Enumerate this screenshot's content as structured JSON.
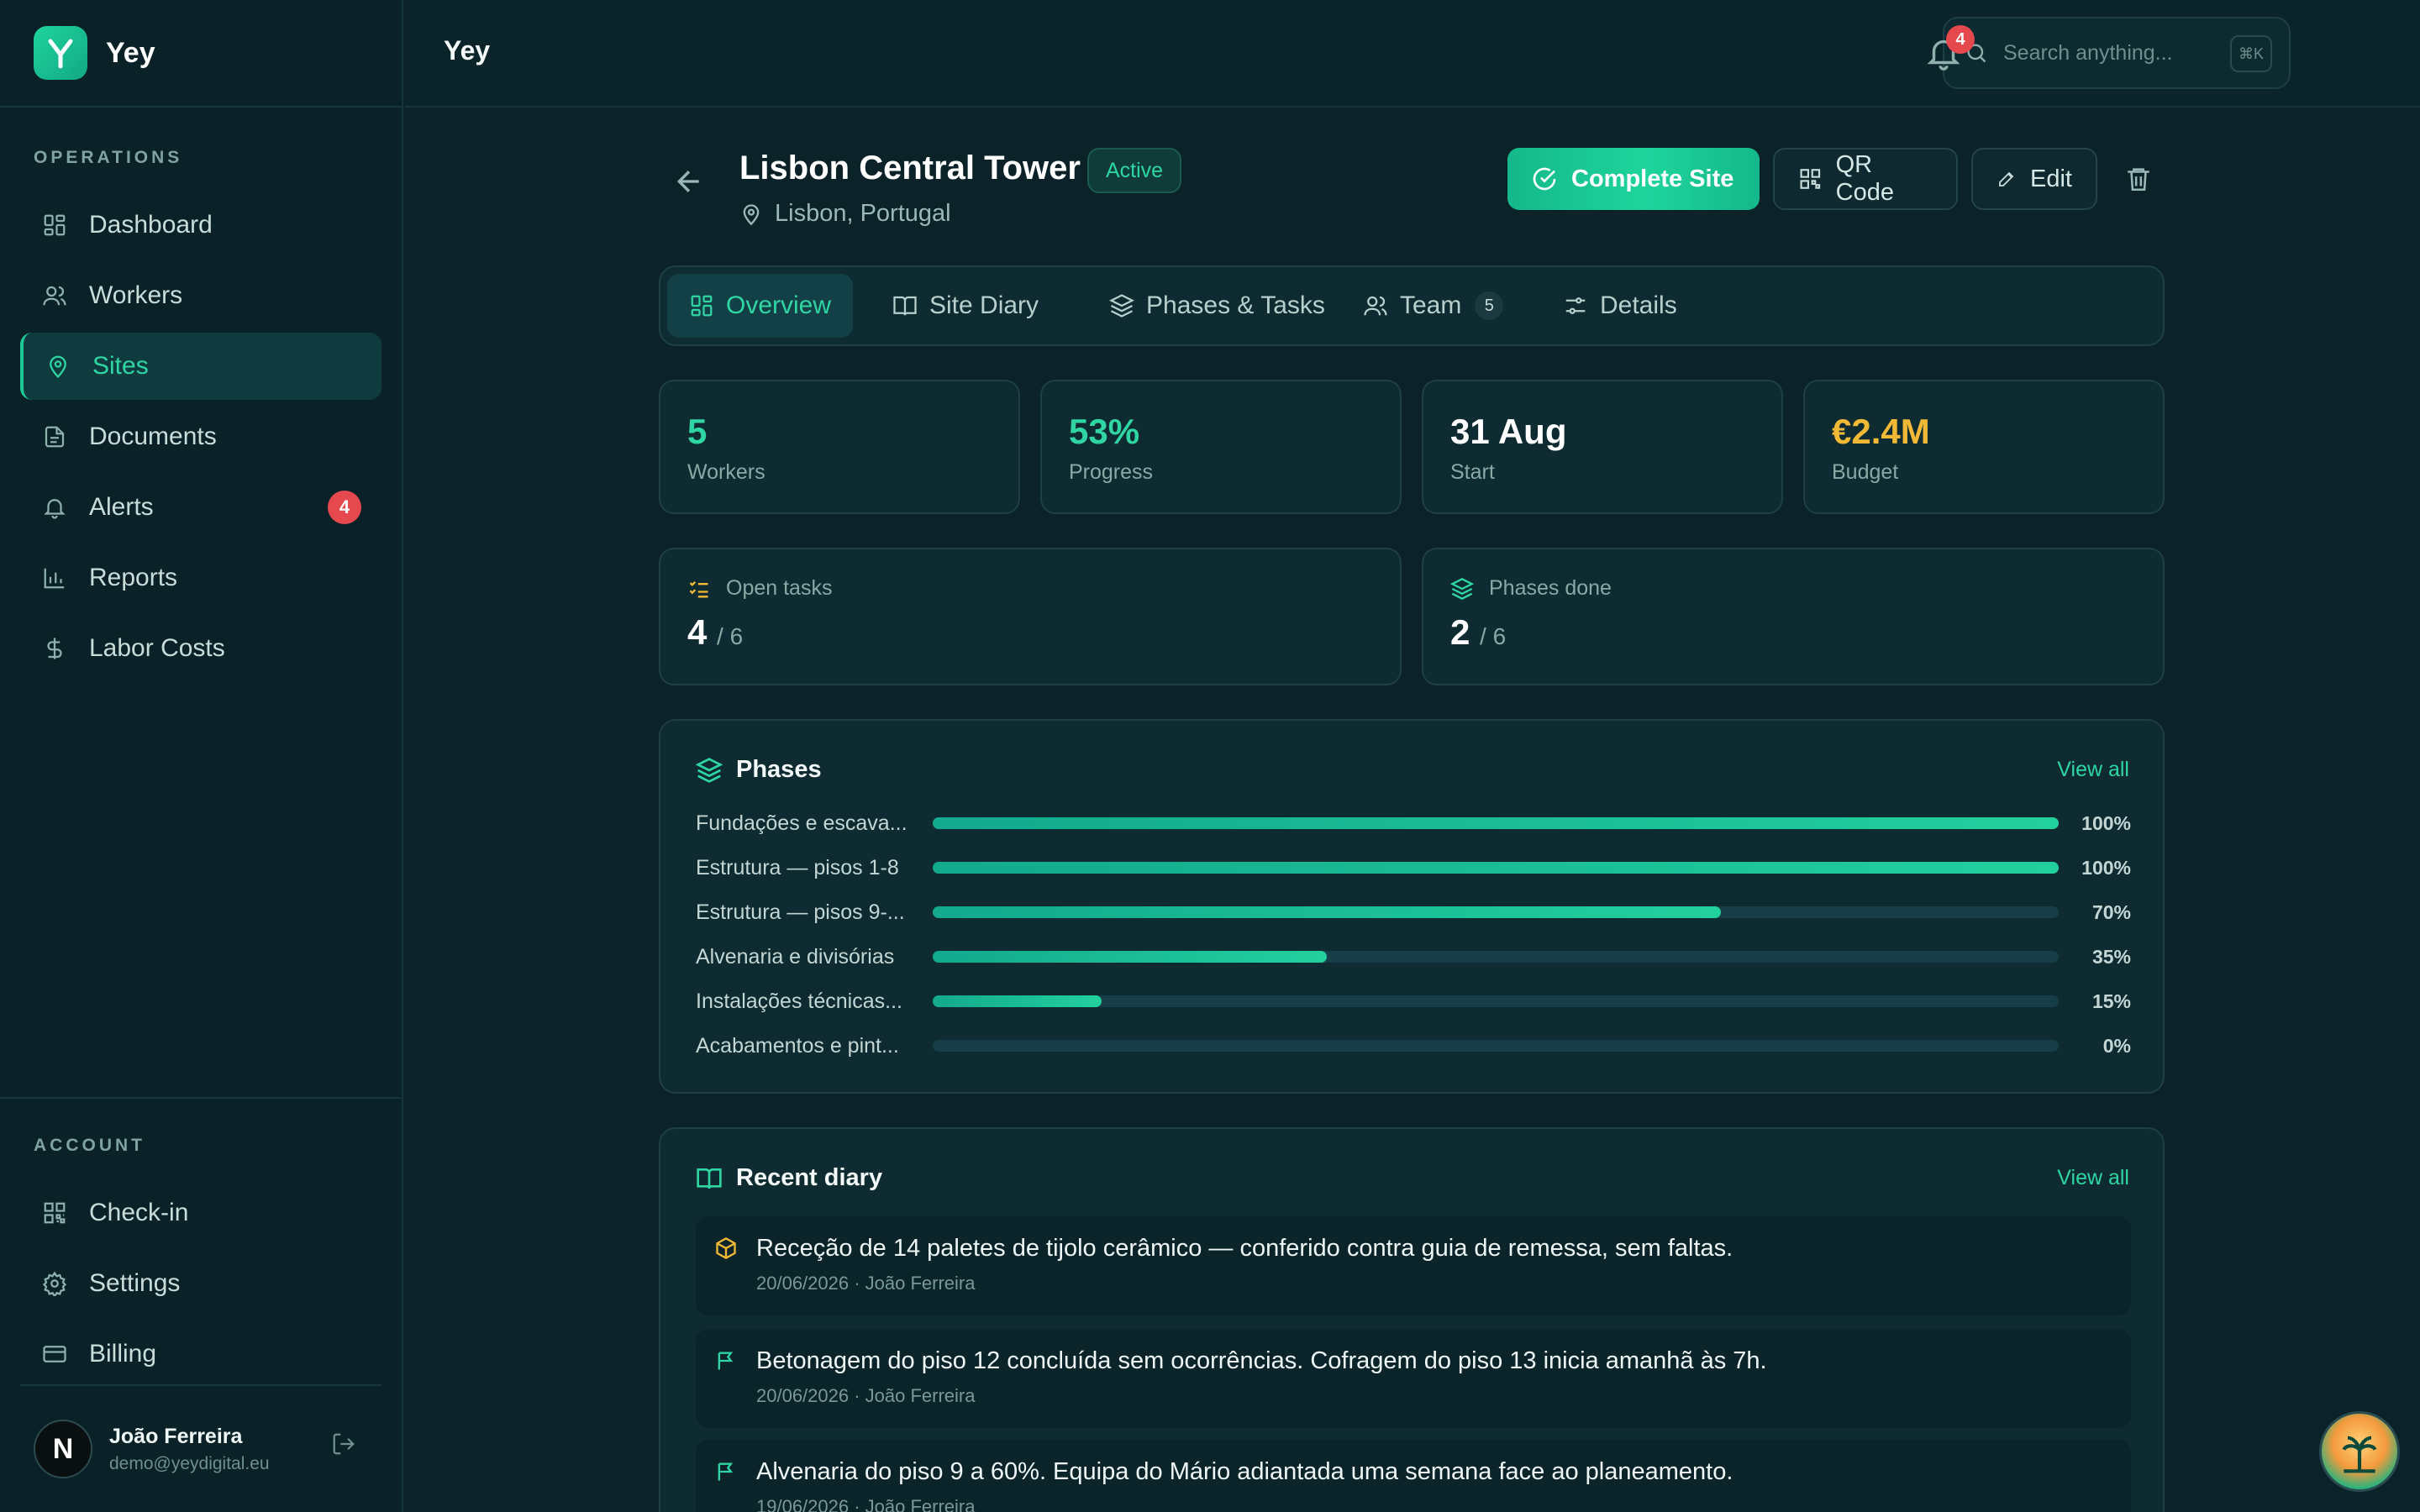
{
  "brand": {
    "name": "Yey"
  },
  "sidebar": {
    "operations_label": "OPERATIONS",
    "items": [
      {
        "label": "Dashboard",
        "icon": "grid-icon"
      },
      {
        "label": "Workers",
        "icon": "users-icon"
      },
      {
        "label": "Sites",
        "icon": "map-pin-icon",
        "active": true
      },
      {
        "label": "Documents",
        "icon": "file-icon"
      },
      {
        "label": "Alerts",
        "icon": "bell-icon",
        "badge": "4"
      },
      {
        "label": "Reports",
        "icon": "bar-chart-icon"
      },
      {
        "label": "Labor Costs",
        "icon": "dollar-icon"
      }
    ],
    "account_label": "ACCOUNT",
    "account_items": [
      {
        "label": "Check-in",
        "icon": "qr-icon"
      },
      {
        "label": "Settings",
        "icon": "gear-icon"
      },
      {
        "label": "Billing",
        "icon": "credit-card-icon"
      }
    ],
    "user": {
      "initial": "N",
      "name": "João Ferreira",
      "email": "demo@yeydigital.eu"
    }
  },
  "topbar": {
    "title": "Yey",
    "search_placeholder": "Search anything...",
    "shortcut": "⌘K",
    "notifications": "4"
  },
  "site": {
    "name": "Lisbon Central Tower",
    "status": "Active",
    "location": "Lisbon, Portugal"
  },
  "actions": {
    "complete": "Complete Site",
    "qr": "QR Code",
    "edit": "Edit"
  },
  "tabs": [
    {
      "label": "Overview",
      "active": true
    },
    {
      "label": "Site Diary"
    },
    {
      "label": "Phases & Tasks"
    },
    {
      "label": "Team",
      "count": "5"
    },
    {
      "label": "Details"
    }
  ],
  "stats": [
    {
      "value": "5",
      "label": "Workers",
      "color": "#2fd6a3"
    },
    {
      "value": "53%",
      "label": "Progress",
      "color": "#2fd6a3"
    },
    {
      "value": "31 Aug",
      "label": "Start",
      "color": "#ffffff"
    },
    {
      "value": "€2.4M",
      "label": "Budget",
      "color": "#f2b937"
    }
  ],
  "open_tasks": {
    "label": "Open tasks",
    "value": "4",
    "total": "/ 6"
  },
  "phases_done": {
    "label": "Phases done",
    "value": "2",
    "total": "/ 6"
  },
  "phases_card": {
    "title": "Phases",
    "view_all": "View all",
    "items": [
      {
        "name": "Fundações e escava...",
        "progress": 100,
        "pct": "100%"
      },
      {
        "name": "Estrutura — pisos 1-8",
        "progress": 100,
        "pct": "100%"
      },
      {
        "name": "Estrutura — pisos 9-...",
        "progress": 70,
        "pct": "70%"
      },
      {
        "name": "Alvenaria e divisórias",
        "progress": 35,
        "pct": "35%"
      },
      {
        "name": "Instalações técnicas...",
        "progress": 15,
        "pct": "15%"
      },
      {
        "name": "Acabamentos e pint...",
        "progress": 0,
        "pct": "0%"
      }
    ]
  },
  "diary_card": {
    "title": "Recent diary",
    "view_all": "View all",
    "items": [
      {
        "icon": "package-icon",
        "text": "Receção de 14 paletes de tijolo cerâmico — conferido contra guia de remessa, sem faltas.",
        "meta": "20/06/2026 · João Ferreira"
      },
      {
        "icon": "flag-icon",
        "text": "Betonagem do piso 12 concluída sem ocorrências. Cofragem do piso 13 inicia amanhã às 7h.",
        "meta": "20/06/2026 · João Ferreira"
      },
      {
        "icon": "flag-icon",
        "text": "Alvenaria do piso 9 a 60%. Equipa do Mário adiantada uma semana face ao planeamento.",
        "meta": "19/06/2026 · João Ferreira"
      }
    ]
  }
}
